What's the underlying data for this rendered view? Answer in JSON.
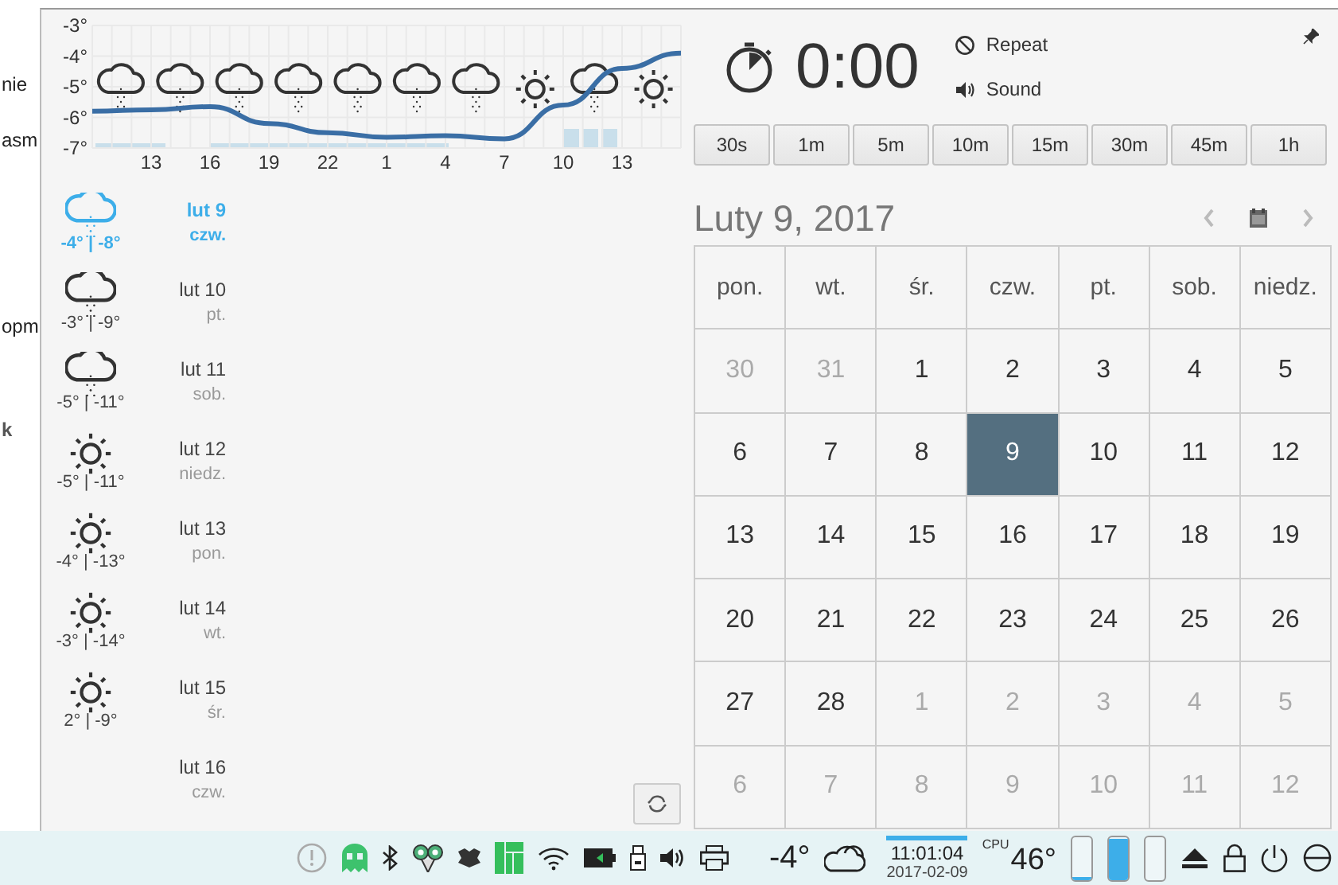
{
  "background_window": {
    "fragments": [
      "nie",
      "asm",
      "opm",
      "k"
    ]
  },
  "weather": {
    "hourly_chart": {
      "chart_data": {
        "type": "line",
        "grid": true,
        "categories": [
          null,
          "13",
          "16",
          "19",
          "22",
          "1",
          "4",
          "7",
          "10",
          "13",
          null
        ],
        "ylim": [
          -7,
          -3
        ],
        "yticks": [
          {
            "value": -3,
            "label": "-3°"
          },
          {
            "value": -4,
            "label": "-4°"
          },
          {
            "value": -5,
            "label": "-5°"
          },
          {
            "value": -6,
            "label": "-6°"
          },
          {
            "value": -7,
            "label": "-7°"
          }
        ],
        "series": [
          {
            "color": "#3a6ea5",
            "values": [
              -5.8,
              -5.75,
              -5.65,
              -6.2,
              -6.5,
              -6.65,
              -6.6,
              -6.7,
              -5.6,
              -4.4,
              -3.9
            ]
          }
        ]
      },
      "icons": [
        {
          "kind": "snow"
        },
        {
          "kind": "snow"
        },
        {
          "kind": "snow"
        },
        {
          "kind": "snow"
        },
        {
          "kind": "snow"
        },
        {
          "kind": "snow"
        },
        {
          "kind": "snow"
        },
        {
          "kind": "sun"
        },
        {
          "kind": "snow"
        },
        {
          "kind": "sun"
        }
      ]
    },
    "days": [
      {
        "kind": "snow",
        "temps": "-4° | -8°",
        "date": "lut 9",
        "weekday": "czw.",
        "selected": true
      },
      {
        "kind": "snow",
        "temps": "-3° | -9°",
        "date": "lut 10",
        "weekday": "pt.",
        "selected": false
      },
      {
        "kind": "snow",
        "temps": "-5° | -11°",
        "date": "lut 11",
        "weekday": "sob.",
        "selected": false
      },
      {
        "kind": "sun",
        "temps": "-5° | -11°",
        "date": "lut 12",
        "weekday": "niedz.",
        "selected": false
      },
      {
        "kind": "sun",
        "temps": "-4° | -13°",
        "date": "lut 13",
        "weekday": "pon.",
        "selected": false
      },
      {
        "kind": "sun",
        "temps": "-3° | -14°",
        "date": "lut 14",
        "weekday": "wt.",
        "selected": false
      },
      {
        "kind": "sun",
        "temps": "2° | -9°",
        "date": "lut 15",
        "weekday": "śr.",
        "selected": false
      },
      {
        "kind": "none",
        "date": "lut 16",
        "weekday": "czw.",
        "selected": false
      }
    ]
  },
  "timer": {
    "time": "0:00",
    "repeat": "Repeat",
    "sound": "Sound",
    "presets": [
      "30s",
      "1m",
      "5m",
      "10m",
      "15m",
      "30m",
      "45m",
      "1h"
    ]
  },
  "calendar": {
    "title": "Luty 9, 2017",
    "weekdays": [
      "pon.",
      "wt.",
      "śr.",
      "czw.",
      "pt.",
      "sob.",
      "niedz."
    ],
    "weeks": [
      [
        {
          "day": "30",
          "current_month": false,
          "selected": false
        },
        {
          "day": "31",
          "current_month": false,
          "selected": false
        },
        {
          "day": "1",
          "current_month": true,
          "selected": false
        },
        {
          "day": "2",
          "current_month": true,
          "selected": false
        },
        {
          "day": "3",
          "current_month": true,
          "selected": false
        },
        {
          "day": "4",
          "current_month": true,
          "selected": false
        },
        {
          "day": "5",
          "current_month": true,
          "selected": false
        }
      ],
      [
        {
          "day": "6",
          "current_month": true,
          "selected": false
        },
        {
          "day": "7",
          "current_month": true,
          "selected": false
        },
        {
          "day": "8",
          "current_month": true,
          "selected": false
        },
        {
          "day": "9",
          "current_month": true,
          "selected": true
        },
        {
          "day": "10",
          "current_month": true,
          "selected": false
        },
        {
          "day": "11",
          "current_month": true,
          "selected": false
        },
        {
          "day": "12",
          "current_month": true,
          "selected": false
        }
      ],
      [
        {
          "day": "13",
          "current_month": true,
          "selected": false
        },
        {
          "day": "14",
          "current_month": true,
          "selected": false
        },
        {
          "day": "15",
          "current_month": true,
          "selected": false
        },
        {
          "day": "16",
          "current_month": true,
          "selected": false
        },
        {
          "day": "17",
          "current_month": true,
          "selected": false
        },
        {
          "day": "18",
          "current_month": true,
          "selected": false
        },
        {
          "day": "19",
          "current_month": true,
          "selected": false
        }
      ],
      [
        {
          "day": "20",
          "current_month": true,
          "selected": false
        },
        {
          "day": "21",
          "current_month": true,
          "selected": false
        },
        {
          "day": "22",
          "current_month": true,
          "selected": false
        },
        {
          "day": "23",
          "current_month": true,
          "selected": false
        },
        {
          "day": "24",
          "current_month": true,
          "selected": false
        },
        {
          "day": "25",
          "current_month": true,
          "selected": false
        },
        {
          "day": "26",
          "current_month": true,
          "selected": false
        }
      ],
      [
        {
          "day": "27",
          "current_month": true,
          "selected": false
        },
        {
          "day": "28",
          "current_month": true,
          "selected": false
        },
        {
          "day": "1",
          "current_month": false,
          "selected": false
        },
        {
          "day": "2",
          "current_month": false,
          "selected": false
        },
        {
          "day": "3",
          "current_month": false,
          "selected": false
        },
        {
          "day": "4",
          "current_month": false,
          "selected": false
        },
        {
          "day": "5",
          "current_month": false,
          "selected": false
        }
      ],
      [
        {
          "day": "6",
          "current_month": false,
          "selected": false
        },
        {
          "day": "7",
          "current_month": false,
          "selected": false
        },
        {
          "day": "8",
          "current_month": false,
          "selected": false
        },
        {
          "day": "9",
          "current_month": false,
          "selected": false
        },
        {
          "day": "10",
          "current_month": false,
          "selected": false
        },
        {
          "day": "11",
          "current_month": false,
          "selected": false
        },
        {
          "day": "12",
          "current_month": false,
          "selected": false
        }
      ]
    ]
  },
  "taskbar": {
    "weather_temp": "-4°",
    "time": "11:01:04",
    "date": "2017-02-09",
    "cpu_label": "CPU",
    "cpu_temp": "46°",
    "meters": [
      {
        "level": 0.05
      },
      {
        "level": 0.95
      },
      {
        "level": 0
      }
    ]
  }
}
